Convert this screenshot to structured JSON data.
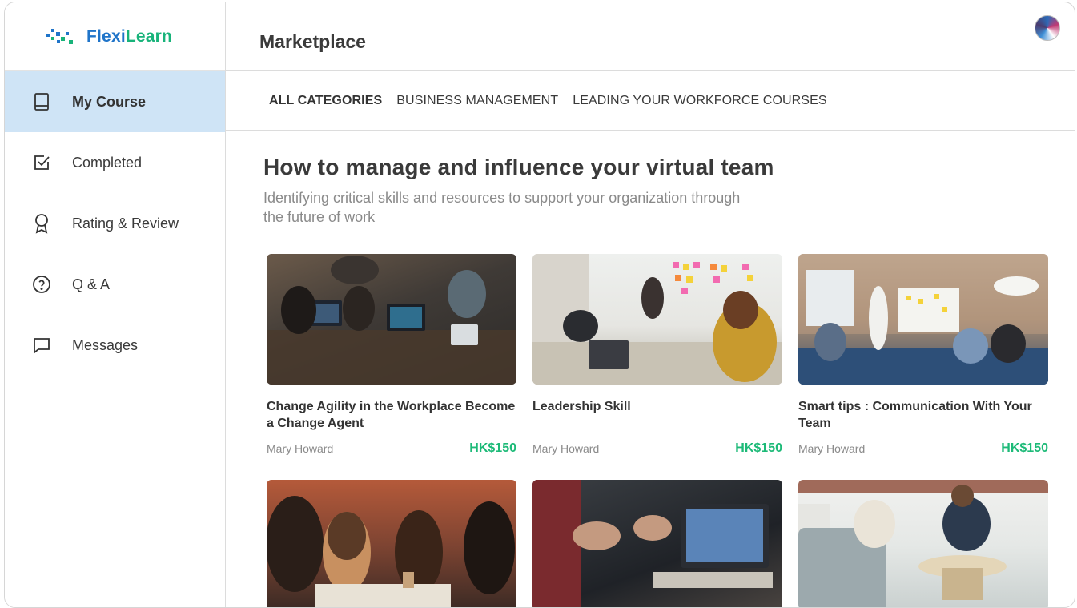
{
  "app": {
    "logo_part1": "Flexi",
    "logo_part2": "Learn",
    "brand_blue": "#1f74c9",
    "brand_green": "#18b37a"
  },
  "sidebar": {
    "items": [
      {
        "label": "My Course",
        "icon": "book-icon",
        "active": true
      },
      {
        "label": "Completed",
        "icon": "checkbox-icon",
        "active": false
      },
      {
        "label": "Rating & Review",
        "icon": "award-icon",
        "active": false
      },
      {
        "label": "Q & A",
        "icon": "question-circle-icon",
        "active": false
      },
      {
        "label": "Messages",
        "icon": "chat-bubble-icon",
        "active": false
      }
    ]
  },
  "header": {
    "title": "Marketplace",
    "avatar_icon": "user-avatar"
  },
  "tabs": [
    {
      "label": "ALL CATEGORIES",
      "active": true
    },
    {
      "label": "BUSINESS MANAGEMENT",
      "active": false
    },
    {
      "label": "LEADING YOUR WORKFORCE COURSES",
      "active": false
    }
  ],
  "section": {
    "headline": "How to manage and influence your virtual team",
    "subtitle": "Identifying critical skills and resources to support your organization through the future of work"
  },
  "courses": [
    {
      "title": "Change Agility in the Workplace Become a Change Agent",
      "author": "Mary Howard",
      "price": "HK$150",
      "image": "team-working-on-laptops-photo"
    },
    {
      "title": "Leadership Skill",
      "author": "Mary Howard",
      "price": "HK$150",
      "image": "whiteboard-sticky-notes-meeting-photo"
    },
    {
      "title": "Smart tips : Communication With Your Team",
      "author": "Mary Howard",
      "price": "HK$150",
      "image": "office-presentation-photo"
    },
    {
      "title": "",
      "author": "",
      "price": "",
      "image": "women-chatting-cafe-photo"
    },
    {
      "title": "",
      "author": "",
      "price": "",
      "image": "laptop-discussion-hands-photo"
    },
    {
      "title": "",
      "author": "",
      "price": "",
      "image": "lounge-conversation-photo"
    }
  ],
  "colors": {
    "active_nav_bg": "#cfe4f6",
    "price_green": "#1dba78"
  }
}
